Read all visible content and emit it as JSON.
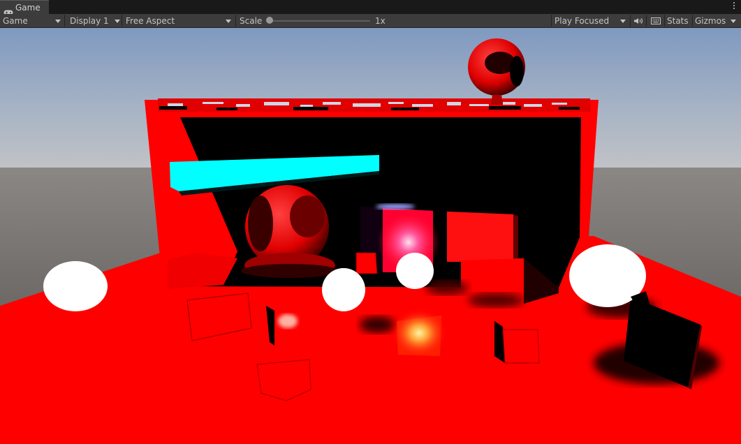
{
  "tab": {
    "title": "Game",
    "icon": "gamepad-icon",
    "menu_icon": "more-vertical-icon"
  },
  "toolbar": {
    "view_mode": "Game",
    "display": "Display 1",
    "aspect": "Free Aspect",
    "scale_label": "Scale",
    "scale_value": "1x",
    "scale_fraction": 0.0,
    "play_mode": "Play Focused",
    "audio_icon": "speaker-icon",
    "grid_icon": "keyboard-icon",
    "stats_label": "Stats",
    "gizmos_label": "Gizmos"
  },
  "colors": {
    "sky_top": "#7f99c0",
    "horizon": "#bfc2c5",
    "ground": "#585351",
    "floor": "#ff0000",
    "cyan_bar": "#00ffff",
    "sphere_white": "#ffffff"
  }
}
